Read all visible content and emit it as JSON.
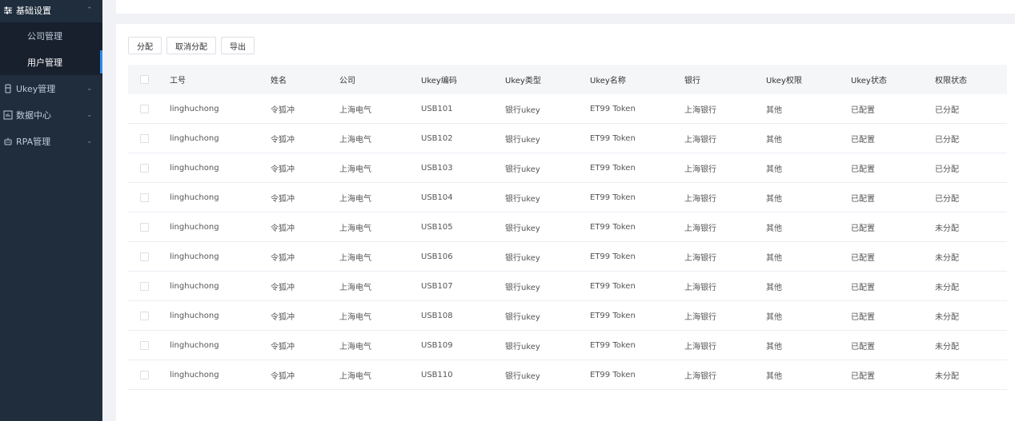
{
  "sidebar": {
    "menu": [
      {
        "label": "基础设置",
        "icon": "sliders-icon"
      },
      {
        "label": "Ukey管理",
        "icon": "ukey-icon"
      },
      {
        "label": "数据中心",
        "icon": "chart-icon"
      },
      {
        "label": "RPA管理",
        "icon": "robot-icon"
      }
    ],
    "submenu": [
      {
        "label": "公司管理"
      },
      {
        "label": "用户管理"
      }
    ]
  },
  "toolbar": {
    "assign": "分配",
    "unassign": "取消分配",
    "export": "导出"
  },
  "table": {
    "columns": [
      "工号",
      "姓名",
      "公司",
      "Ukey编码",
      "Ukey类型",
      "Ukey名称",
      "银行",
      "Ukey权限",
      "Ukey状态",
      "权限状态"
    ],
    "rows": [
      [
        "linghuchong",
        "令狐冲",
        "上海电气",
        "USB101",
        "银行ukey",
        "ET99 Token",
        "上海银行",
        "其他",
        "已配置",
        "已分配"
      ],
      [
        "linghuchong",
        "令狐冲",
        "上海电气",
        "USB102",
        "银行ukey",
        "ET99 Token",
        "上海银行",
        "其他",
        "已配置",
        "已分配"
      ],
      [
        "linghuchong",
        "令狐冲",
        "上海电气",
        "USB103",
        "银行ukey",
        "ET99 Token",
        "上海银行",
        "其他",
        "已配置",
        "已分配"
      ],
      [
        "linghuchong",
        "令狐冲",
        "上海电气",
        "USB104",
        "银行ukey",
        "ET99 Token",
        "上海银行",
        "其他",
        "已配置",
        "已分配"
      ],
      [
        "linghuchong",
        "令狐冲",
        "上海电气",
        "USB105",
        "银行ukey",
        "ET99 Token",
        "上海银行",
        "其他",
        "已配置",
        "未分配"
      ],
      [
        "linghuchong",
        "令狐冲",
        "上海电气",
        "USB106",
        "银行ukey",
        "ET99 Token",
        "上海银行",
        "其他",
        "已配置",
        "未分配"
      ],
      [
        "linghuchong",
        "令狐冲",
        "上海电气",
        "USB107",
        "银行ukey",
        "ET99 Token",
        "上海银行",
        "其他",
        "已配置",
        "未分配"
      ],
      [
        "linghuchong",
        "令狐冲",
        "上海电气",
        "USB108",
        "银行ukey",
        "ET99 Token",
        "上海银行",
        "其他",
        "已配置",
        "未分配"
      ],
      [
        "linghuchong",
        "令狐冲",
        "上海电气",
        "USB109",
        "银行ukey",
        "ET99 Token",
        "上海银行",
        "其他",
        "已配置",
        "未分配"
      ],
      [
        "linghuchong",
        "令狐冲",
        "上海电气",
        "USB110",
        "银行ukey",
        "ET99 Token",
        "上海银行",
        "其他",
        "已配置",
        "未分配"
      ]
    ]
  }
}
